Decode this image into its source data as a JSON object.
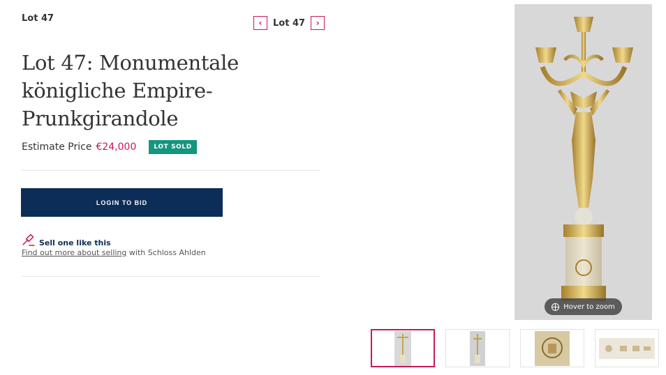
{
  "lot": {
    "label": "Lot 47",
    "nav_label": "Lot 47",
    "prev_icon": "chevron-left-icon",
    "next_icon": "chevron-right-icon"
  },
  "title": "Lot 47: Monumentale königliche Empire-Prunkgirandole",
  "estimate": {
    "label": "Estimate Price",
    "value": "€24,000",
    "badge": "LOT SOLD"
  },
  "actions": {
    "login_label": "LOGIN TO BID"
  },
  "sell": {
    "title": "Sell one like this",
    "link_text": "Find out more about selling",
    "suffix": " with Schloss Ahlden"
  },
  "gallery": {
    "zoom_hint": "Hover to zoom",
    "thumbnails": [
      "candelabra-front",
      "candelabra-side",
      "coat-of-arms",
      "hallmarks"
    ],
    "selected_index": 0
  },
  "colors": {
    "accent": "#c8175d",
    "primary": "#0c2d57",
    "sold": "#14967f"
  }
}
